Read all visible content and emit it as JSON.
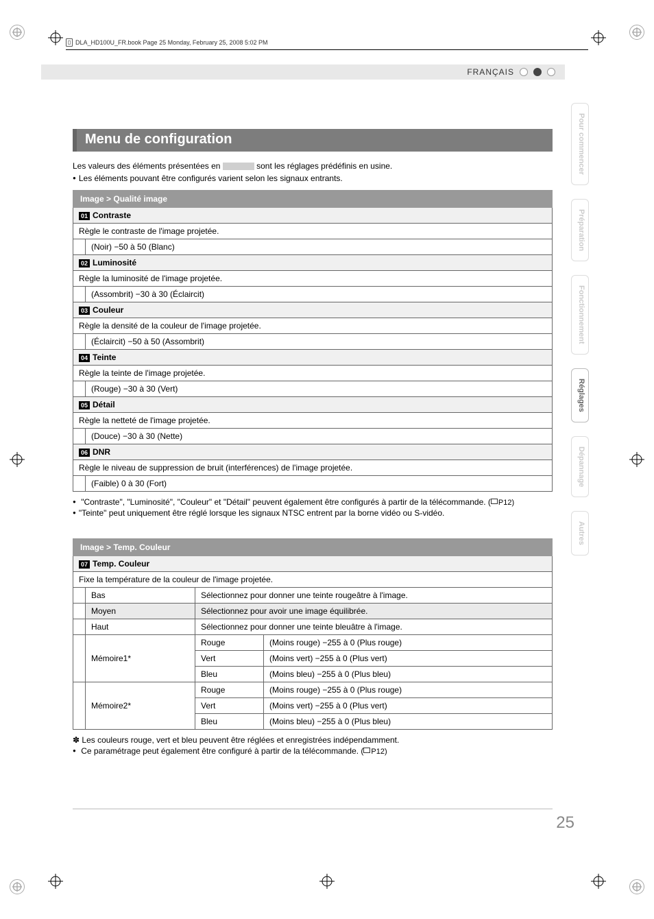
{
  "running_head": "DLA_HD100U_FR.book  Page 25  Monday, February 25, 2008  5:02 PM",
  "language_label": "FRANÇAIS",
  "side_tabs": [
    "Pour commencer",
    "Préparation",
    "Fonctionnement",
    "Réglages",
    "Dépannage",
    "Autres"
  ],
  "active_tab_index": 3,
  "title": "Menu de configuration",
  "intro_before": "Les valeurs des éléments présentées en ",
  "intro_after": " sont les réglages prédéfinis en usine.",
  "intro_bullet": "Les éléments pouvant être configurés varient selon les signaux entrants.",
  "table1_header": "Image > Qualité image",
  "items1": [
    {
      "num": "01",
      "name": "Contraste",
      "desc": "Règle le contraste de l'image projetée.",
      "range": "(Noir) −50 à 50 (Blanc)"
    },
    {
      "num": "02",
      "name": "Luminosité",
      "desc": "Règle la luminosité de l'image projetée.",
      "range": "(Assombrit) −30 à 30 (Éclaircit)"
    },
    {
      "num": "03",
      "name": "Couleur",
      "desc": "Règle la densité de la couleur de l'image projetée.",
      "range": "(Éclaircit) −50 à 50 (Assombrit)"
    },
    {
      "num": "04",
      "name": "Teinte",
      "desc": "Règle la teinte de l'image projetée.",
      "range": "(Rouge) −30 à 30 (Vert)"
    },
    {
      "num": "05",
      "name": "Détail",
      "desc": "Règle la netteté de l'image projetée.",
      "range": "(Douce) −30 à 30 (Nette)"
    },
    {
      "num": "06",
      "name": "DNR",
      "desc": "Règle le niveau de suppression de bruit (interférences) de l'image projetée.",
      "range": "(Faible) 0 à 30 (Fort)"
    }
  ],
  "notes1": [
    "\"Contraste\", \"Luminosité\", \"Couleur\" et \"Détail\" peuvent également être configurés à partir de la télécommande. (",
    "\"Teinte\" peut uniquement être réglé lorsque les signaux NTSC entrent par la borne vidéo ou S-vidéo."
  ],
  "pref1": "P12)",
  "table2_header": "Image > Temp. Couleur",
  "item07_num": "07",
  "item07_name": "Temp. Couleur",
  "item07_desc": "Fixe la température de la couleur de l'image projetée.",
  "rows2": [
    {
      "label": "Bas",
      "desc": "Sélectionnez pour donner une teinte rougeâtre à l'image."
    },
    {
      "label": "Moyen",
      "desc": "Sélectionnez pour avoir une image équilibrée.",
      "shade": true
    },
    {
      "label": "Haut",
      "desc": "Sélectionnez pour donner une teinte bleuâtre à l'image."
    }
  ],
  "mem_rows": [
    {
      "label": "Mémoire1*",
      "channels": [
        {
          "c": "Rouge",
          "r": "(Moins rouge) −255 à 0 (Plus rouge)"
        },
        {
          "c": "Vert",
          "r": "(Moins vert) −255 à 0 (Plus vert)"
        },
        {
          "c": "Bleu",
          "r": "(Moins bleu) −255 à 0 (Plus bleu)"
        }
      ]
    },
    {
      "label": "Mémoire2*",
      "channels": [
        {
          "c": "Rouge",
          "r": "(Moins rouge) −255 à 0 (Plus rouge)"
        },
        {
          "c": "Vert",
          "r": "(Moins vert) −255 à 0 (Plus vert)"
        },
        {
          "c": "Bleu",
          "r": "(Moins bleu) −255 à 0 (Plus bleu)"
        }
      ]
    }
  ],
  "footnote2": "Les couleurs rouge, vert et bleu peuvent être réglées et enregistrées indépendamment.",
  "note2": "Ce paramétrage peut également être configuré à partir de la télécommande. (",
  "pref2": "P12)",
  "page_number": "25"
}
